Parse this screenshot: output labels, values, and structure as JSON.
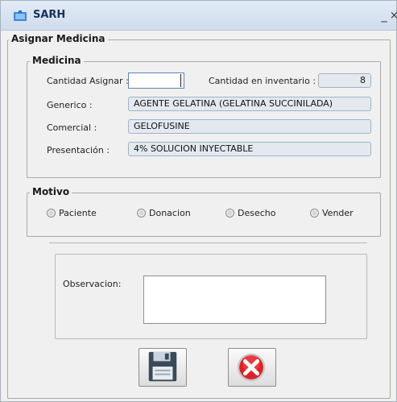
{
  "window": {
    "title": "SARH",
    "minimize_label": "_",
    "close_label": "×"
  },
  "assign_group": {
    "legend": "Asignar Medicina"
  },
  "medicine_group": {
    "legend": "Medicina",
    "quantity_label": "Cantidad Asignar :",
    "quantity_value": "",
    "inventory_label": "Cantidad en inventario :",
    "inventory_value": "8",
    "generic_label": "Generico :",
    "generic_value": "AGENTE GELATINA (GELATINA SUCCINILADA)",
    "commercial_label": "Comercial :",
    "commercial_value": "GELOFUSINE",
    "presentation_label": "Presentación :",
    "presentation_value": "4%  SOLUCION INYECTABLE"
  },
  "motive_group": {
    "legend": "Motivo",
    "options": [
      "Paciente",
      "Donacion",
      "Desecho",
      "Vender"
    ]
  },
  "observation": {
    "label": "Observacion:",
    "value": ""
  },
  "actions": {
    "save_icon": "floppy-disk-icon",
    "cancel_icon": "red-x-circle-icon"
  }
}
